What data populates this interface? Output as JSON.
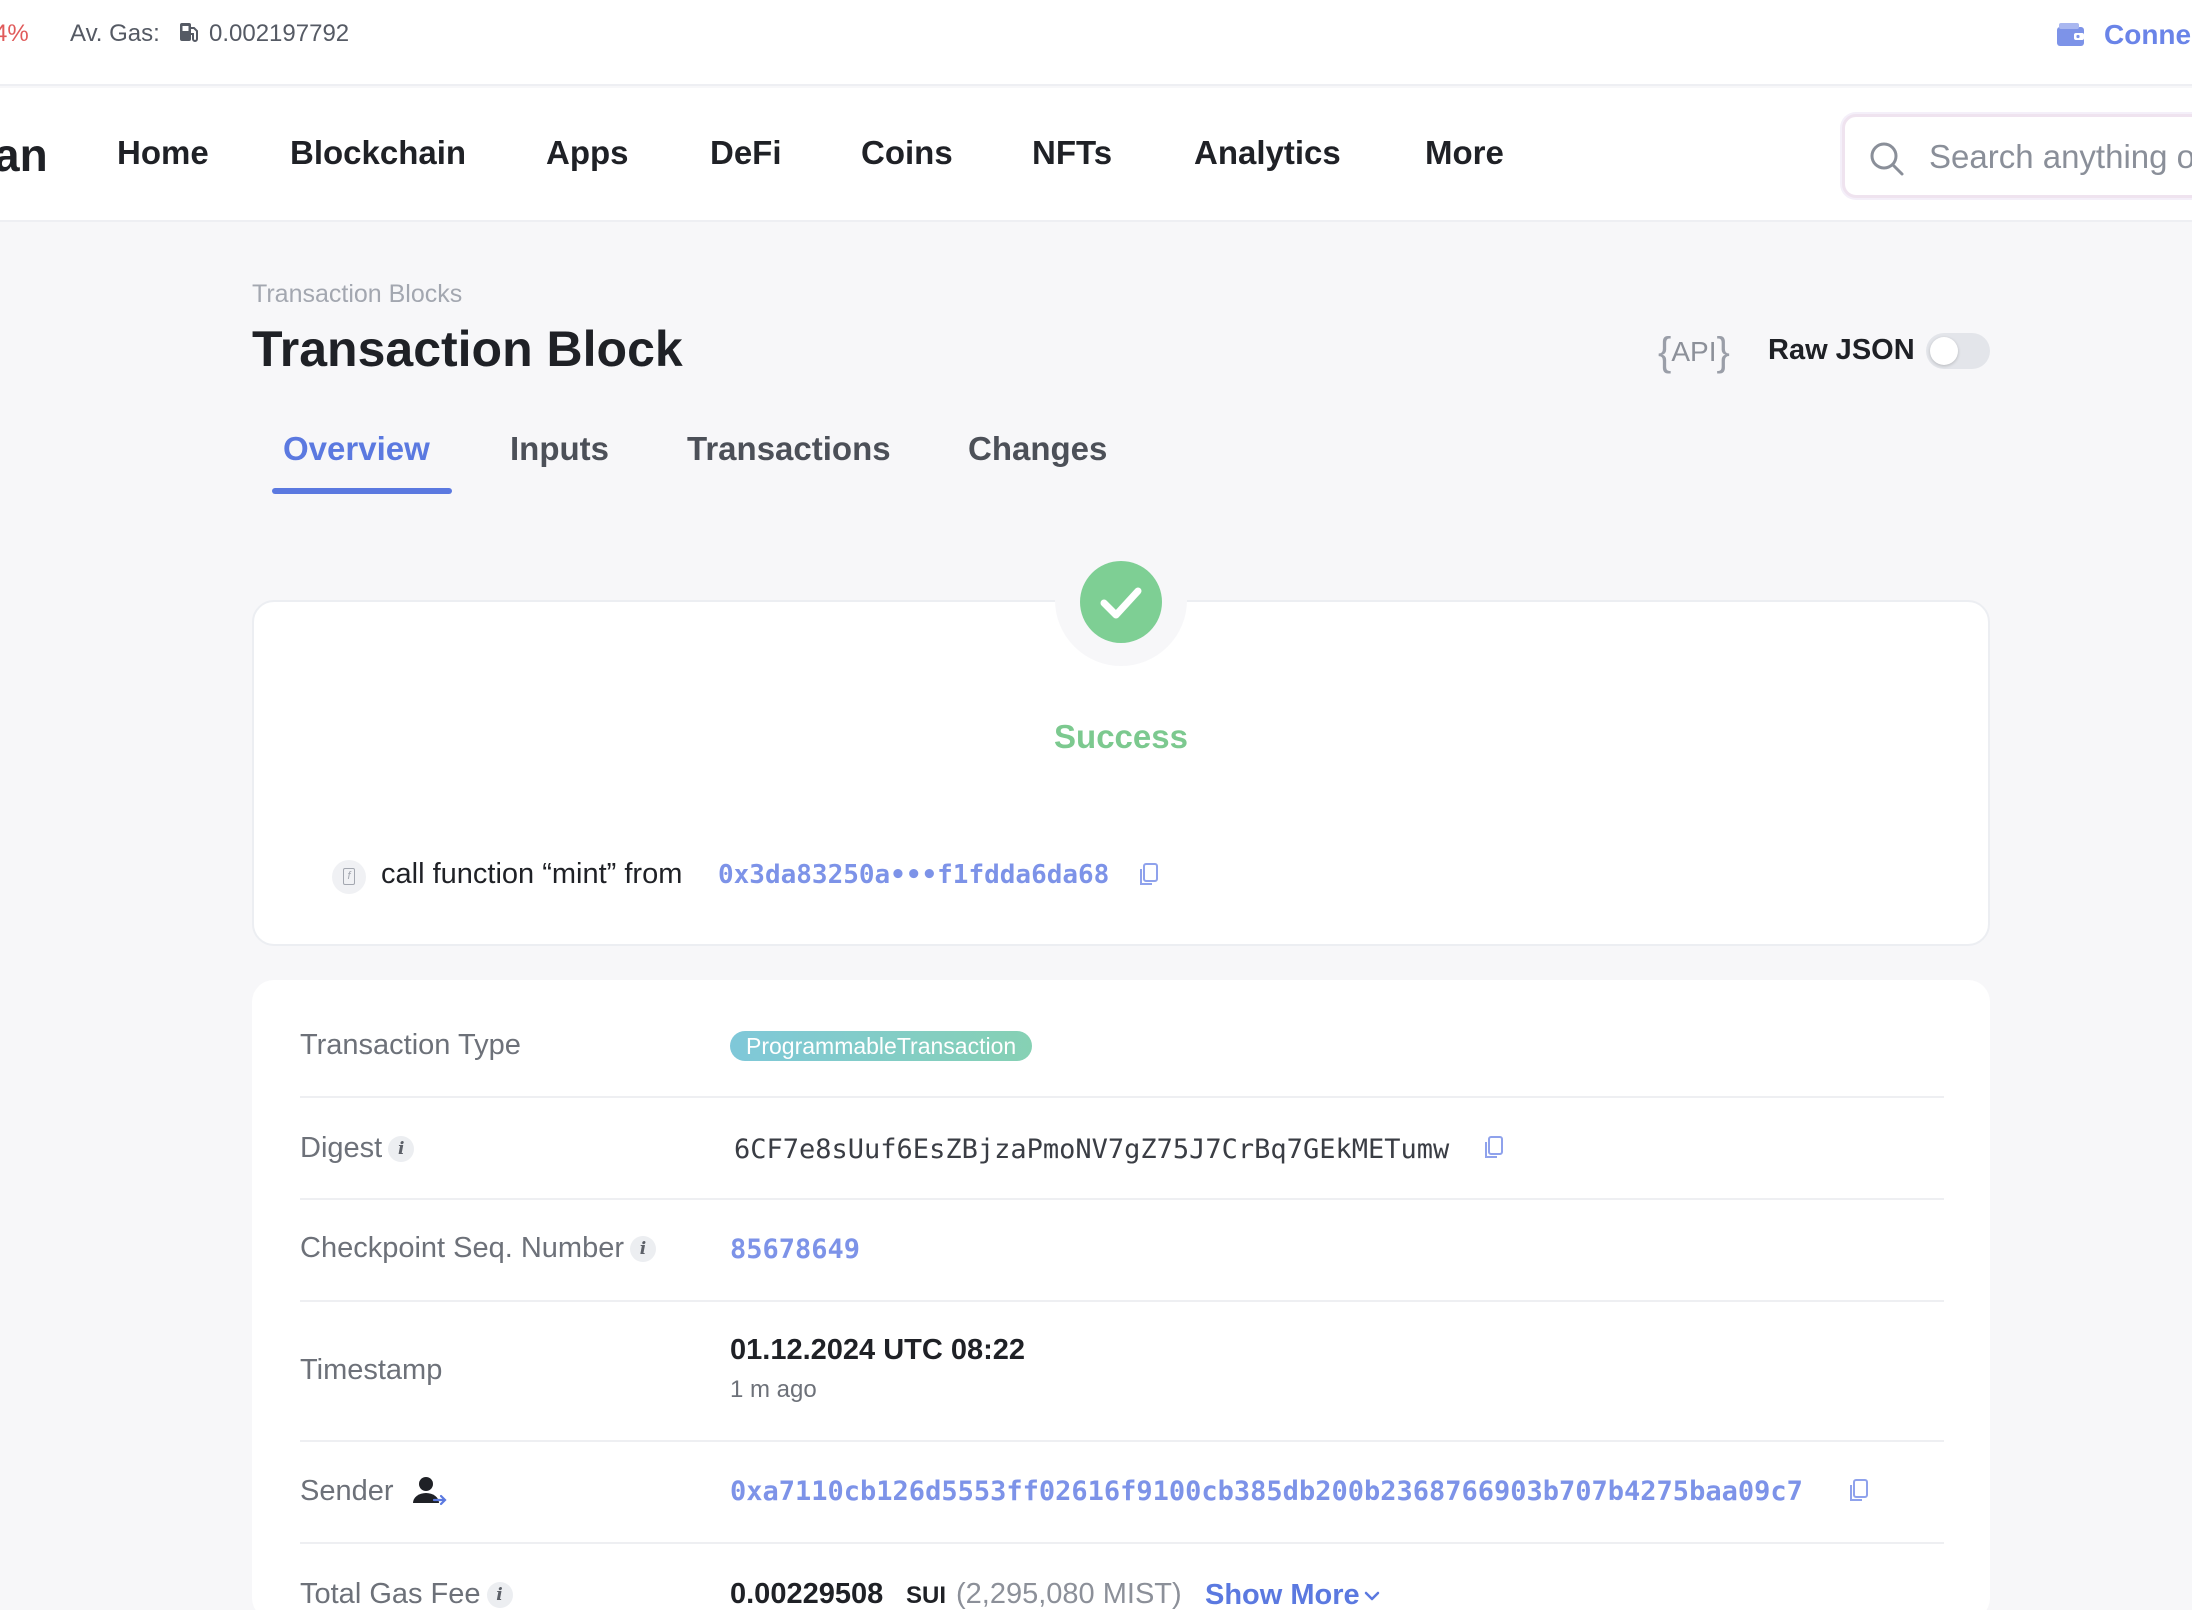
{
  "topbar": {
    "price_change": "4%",
    "gas_label": "Av. Gas:",
    "gas_value": "0.002197792",
    "connect_label": "Connect"
  },
  "nav": {
    "logo_text": "an",
    "items": [
      "Home",
      "Blockchain",
      "Apps",
      "DeFi",
      "Coins",
      "NFTs",
      "Analytics",
      "More"
    ],
    "search_placeholder": "Search anything on"
  },
  "header": {
    "breadcrumb": "Transaction Blocks",
    "title": "Transaction Block",
    "api_label": "API",
    "raw_json_label": "Raw JSON",
    "raw_json_enabled": false
  },
  "tabs": [
    {
      "label": "Overview",
      "active": true
    },
    {
      "label": "Inputs",
      "active": false
    },
    {
      "label": "Transactions",
      "active": false
    },
    {
      "label": "Changes",
      "active": false
    }
  ],
  "status": {
    "text": "Success",
    "color": "#7ecf94",
    "call_text": "call function “mint” from",
    "call_address": "0x3da83250a•••f1fdda6da68"
  },
  "details": {
    "transaction_type_label": "Transaction Type",
    "transaction_type": "ProgrammableTransaction",
    "digest_label": "Digest",
    "digest": "6CF7e8sUuf6EsZBjzaPmoNV7gZ75J7CrBq7GEkMETumw",
    "checkpoint_label": "Checkpoint Seq. Number",
    "checkpoint": "85678649",
    "timestamp_label": "Timestamp",
    "timestamp": "01.12.2024 UTC 08:22",
    "timestamp_ago": "1 m ago",
    "sender_label": "Sender",
    "sender": "0xa7110cb126d5553ff02616f9100cb385db200b2368766903b707b4275baa09c7",
    "gas_fee_label": "Total Gas Fee",
    "gas_fee": "0.00229508",
    "gas_fee_unit": "SUI",
    "gas_fee_mist": "(2,295,080 MIST)",
    "show_more_label": "Show More"
  },
  "colors": {
    "accent": "#5b79e0",
    "link": "#7d93e8",
    "success": "#7ecf94",
    "negative": "#e05a5a"
  }
}
